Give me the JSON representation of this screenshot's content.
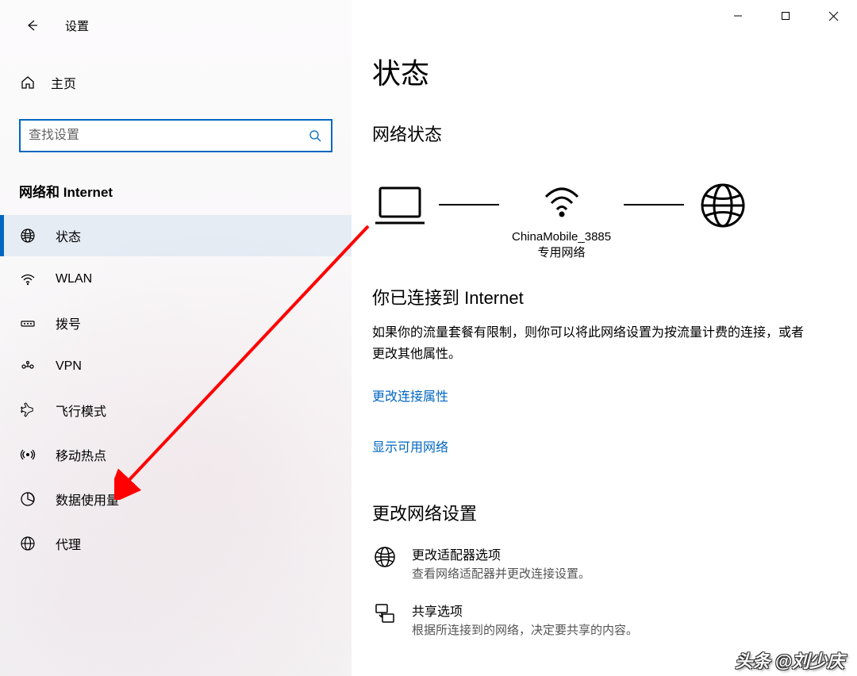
{
  "app": {
    "title": "设置"
  },
  "sidebar": {
    "home_label": "主页",
    "search_placeholder": "查找设置",
    "category": "网络和 Internet",
    "items": [
      {
        "label": "状态"
      },
      {
        "label": "WLAN"
      },
      {
        "label": "拨号"
      },
      {
        "label": "VPN"
      },
      {
        "label": "飞行模式"
      },
      {
        "label": "移动热点"
      },
      {
        "label": "数据使用量"
      },
      {
        "label": "代理"
      }
    ]
  },
  "content": {
    "title": "状态",
    "network_status_heading": "网络状态",
    "wifi_name": "ChinaMobile_3885",
    "wifi_type": "专用网络",
    "connected_heading": "你已连接到 Internet",
    "connected_desc": "如果你的流量套餐有限制，则你可以将此网络设置为按流量计费的连接，或者更改其他属性。",
    "link_properties": "更改连接属性",
    "link_available": "显示可用网络",
    "change_settings_heading": "更改网络设置",
    "options": [
      {
        "title": "更改适配器选项",
        "desc": "查看网络适配器并更改连接设置。"
      },
      {
        "title": "共享选项",
        "desc": "根据所连接到的网络，决定要共享的内容。"
      }
    ]
  },
  "watermark": "头条 @刘少庆"
}
